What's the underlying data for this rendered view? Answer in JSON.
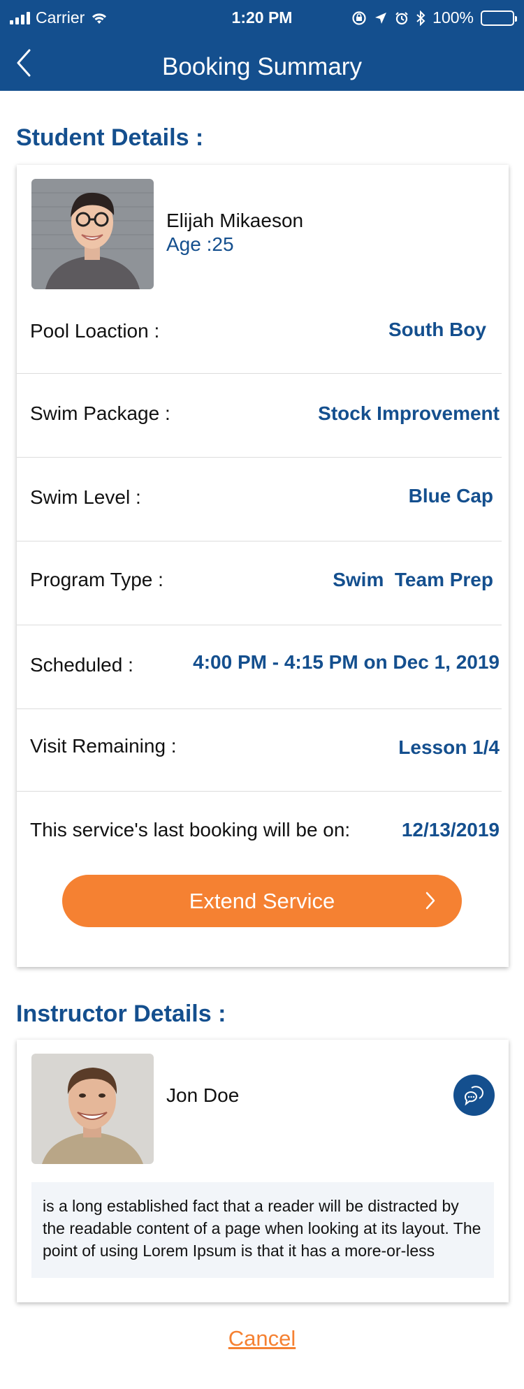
{
  "status_bar": {
    "carrier": "Carrier",
    "time": "1:20 PM",
    "battery": "100%"
  },
  "nav": {
    "title": "Booking Summary",
    "back_icon": "chevron-left-icon"
  },
  "student_section": {
    "title": "Student Details :",
    "name": "Elijah Mikaeson",
    "age": "Age :25",
    "rows": [
      {
        "label": "Pool Loaction :",
        "value": "South Boy"
      },
      {
        "label": "Swim Package :",
        "value": "Stock Improvement"
      },
      {
        "label": "Swim Level :",
        "value": "Blue Cap"
      },
      {
        "label": "Program Type :",
        "value": "Swim  Team Prep"
      },
      {
        "label": "Scheduled :",
        "value": "4:00 PM - 4:15 PM on Dec 1, 2019"
      },
      {
        "label": "Visit Remaining :",
        "value": "Lesson 1/4"
      },
      {
        "label": "This service's last booking will be on:",
        "value": "12/13/2019"
      }
    ],
    "extend_button": "Extend Service"
  },
  "instructor_section": {
    "title": "Instructor Details :",
    "name": "Jon Doe",
    "chat_icon": "chat-bubble-icon",
    "bio": "is a long established fact that a reader will be distracted by the readable content of a page when looking at its layout. The point of using Lorem Ipsum is that it has a more-or-less"
  },
  "cancel_label": "Cancel",
  "colors": {
    "primary": "#144f8e",
    "accent": "#f58132",
    "bio_bg": "#f2f5f9"
  }
}
